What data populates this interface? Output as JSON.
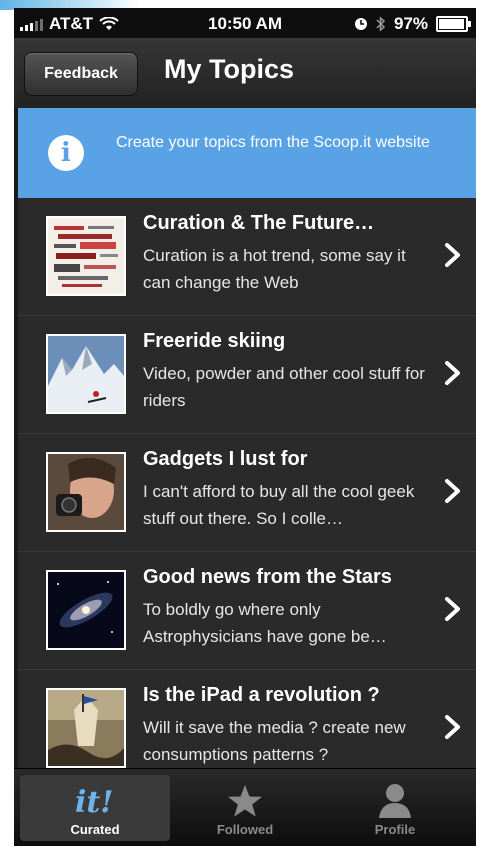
{
  "status_bar": {
    "carrier": "AT&T",
    "time": "10:50 AM",
    "battery": "97%"
  },
  "nav": {
    "feedback_label": "Feedback",
    "title": "My Topics"
  },
  "info_banner": {
    "text": "Create your topics from the Scoop.it website"
  },
  "topics": [
    {
      "title": "Curation & The Future…",
      "description": "Curation is a hot trend, some say it can change the Web"
    },
    {
      "title": "Freeride skiing",
      "description": "Video, powder and other cool stuff for riders"
    },
    {
      "title": "Gadgets I lust for",
      "description": "I can't afford to buy all the cool geek stuff out there. So I colle…"
    },
    {
      "title": "Good news from the Stars",
      "description": "To boldly go where only Astrophysicians have gone be…"
    },
    {
      "title": "Is the iPad a revolution ?",
      "description": "Will it save the media ? create new consumptions patterns ?"
    }
  ],
  "tabs": [
    {
      "label": "Curated",
      "icon": "scoopit-it-icon",
      "active": true
    },
    {
      "label": "Followed",
      "icon": "star-icon",
      "active": false
    },
    {
      "label": "Profile",
      "icon": "person-icon",
      "active": false
    }
  ],
  "colors": {
    "banner": "#5aa2e6",
    "row_background": "#2a2a2a",
    "accent_blue": "#5fb4e6"
  }
}
